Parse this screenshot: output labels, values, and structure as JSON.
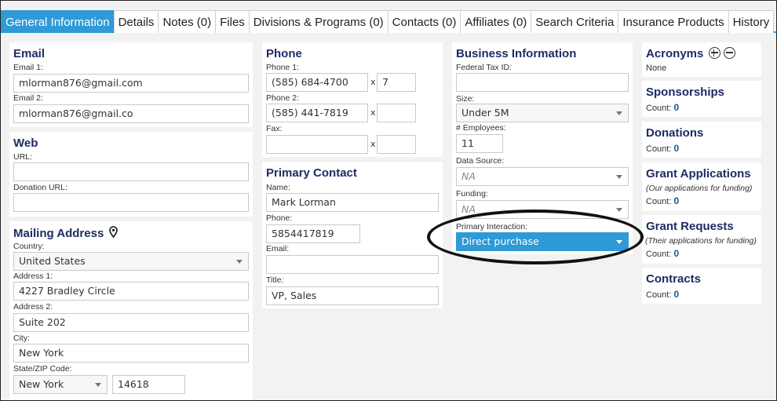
{
  "tabs": [
    {
      "label": "General Information",
      "active": true
    },
    {
      "label": "Details"
    },
    {
      "label": "Notes (0)"
    },
    {
      "label": "Files"
    },
    {
      "label": "Divisions & Programs (0)"
    },
    {
      "label": "Contacts (0)"
    },
    {
      "label": "Affiliates (0)"
    },
    {
      "label": "Search Criteria"
    },
    {
      "label": "Insurance Products"
    },
    {
      "label": "History"
    }
  ],
  "email": {
    "title": "Email",
    "email1_label": "Email 1:",
    "email1_value": "mlorman876@gmail.com",
    "email2_label": "Email 2:",
    "email2_value": "mlorman876@gmail.co"
  },
  "web": {
    "title": "Web",
    "url_label": "URL:",
    "url_value": "",
    "donation_label": "Donation URL:",
    "donation_value": ""
  },
  "mailing": {
    "title": "Mailing Address",
    "country_label": "Country:",
    "country_value": "United States",
    "addr1_label": "Address 1:",
    "addr1_value": "4227 Bradley Circle",
    "addr2_label": "Address 2:",
    "addr2_value": "Suite 202",
    "city_label": "City:",
    "city_value": "New York",
    "statezip_label": "State/ZIP Code:",
    "state_value": "New York",
    "zip_value": "14618"
  },
  "phone": {
    "title": "Phone",
    "phone1_label": "Phone 1:",
    "phone1_value": "(585) 684-4700",
    "phone1_ext": "7",
    "phone2_label": "Phone 2:",
    "phone2_value": "(585) 441-7819",
    "phone2_ext": "",
    "fax_label": "Fax:",
    "fax_value": "",
    "fax_ext": "",
    "ext_sep": "x"
  },
  "primary_contact": {
    "title": "Primary Contact",
    "name_label": "Name:",
    "name_value": "Mark Lorman",
    "phone_label": "Phone:",
    "phone_value": "5854417819",
    "email_label": "Email:",
    "email_value": "",
    "title_label": "Title:",
    "title_value": "VP, Sales"
  },
  "business": {
    "title": "Business Information",
    "taxid_label": "Federal Tax ID:",
    "taxid_value": "",
    "size_label": "Size:",
    "size_value": "Under 5M",
    "employees_label": "# Employees:",
    "employees_value": "11",
    "datasource_label": "Data Source:",
    "datasource_value": "NA",
    "funding_label": "Funding:",
    "funding_value": "NA",
    "interaction_label": "Primary Interaction:",
    "interaction_value": "Direct purchase"
  },
  "sidebar": {
    "acronyms_title": "Acronyms",
    "acronyms_value": "None",
    "sponsorships_title": "Sponsorships",
    "sponsorships_count_label": "Count:",
    "sponsorships_count": "0",
    "donations_title": "Donations",
    "donations_count_label": "Count:",
    "donations_count": "0",
    "grantapps_title": "Grant Applications",
    "grantapps_sub": "(Our applications for funding)",
    "grantapps_count_label": "Count:",
    "grantapps_count": "0",
    "grantreq_title": "Grant Requests",
    "grantreq_sub": "(Their applications for funding)",
    "grantreq_count_label": "Count:",
    "grantreq_count": "0",
    "contracts_title": "Contracts",
    "contracts_count_label": "Count:",
    "contracts_count": "0"
  },
  "colors": {
    "accent": "#2e9ad7",
    "heading": "#1c2d63",
    "count": "#1c55a8"
  }
}
